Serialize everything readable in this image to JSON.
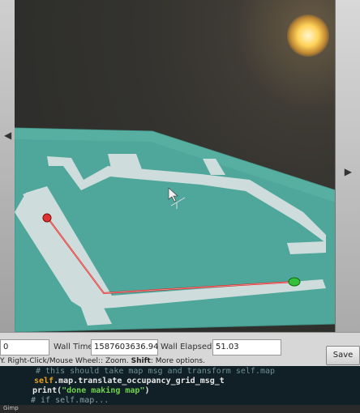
{
  "window": {
    "left_field_value": "0",
    "wall_time_label": "Wall Time:",
    "wall_time_value": "1587603636.94",
    "wall_elapsed_label": "Wall Elapsed:",
    "wall_elapsed_value": "51.03",
    "save_label": "Save"
  },
  "hint": {
    "text_a": "Y. Right-Click/Mouse Wheel:: Zoom. ",
    "shift": "Shift",
    "text_b": ": More options."
  },
  "code": {
    "line1": "# this should take map msg and transform self.map",
    "line2_self": "self",
    "line2_rest": ".map.translate_occupancy_grid_msg_t",
    "line3_func": "print(",
    "line3_str": "\"done making map\"",
    "line3_close": ")",
    "line4": "# if self.map..."
  },
  "taskbar": {
    "label": "Gimp"
  },
  "icons": {
    "left": "chevron-left-icon",
    "right": "chevron-right-icon",
    "cursor": "mouse-cursor-icon",
    "start": "start-marker-icon",
    "goal": "goal-marker-icon"
  },
  "colors": {
    "map_floor": "#4ea79a",
    "path": "#e01818",
    "start_marker": "#e03030",
    "goal_marker": "#35c23a",
    "free_space": "#d9e2e2"
  }
}
